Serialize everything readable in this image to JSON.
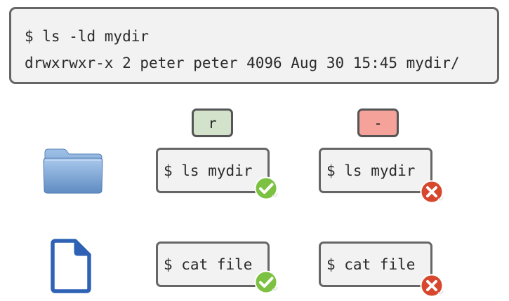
{
  "terminal": {
    "command": "$ ls -ld mydir",
    "output": "drwxrwxr-x 2 peter peter 4096 Aug 30 15:45 mydir/"
  },
  "columns": {
    "read_permission": "r",
    "no_permission": "-"
  },
  "rows": [
    {
      "icon": "folder-icon",
      "with_read": {
        "command": "$ ls mydir",
        "result": "success"
      },
      "without_read": {
        "command": "$ ls mydir",
        "result": "failure"
      }
    },
    {
      "icon": "file-icon",
      "with_read": {
        "command": "$ cat file",
        "result": "success"
      },
      "without_read": {
        "command": "$ cat file",
        "result": "failure"
      }
    }
  ],
  "colors": {
    "read_badge": "#d3e2cb",
    "none_badge": "#f4a29a",
    "success": "#7cc142",
    "failure": "#d6472e",
    "folder": "#7fa7d6",
    "file": "#2f62b5"
  }
}
